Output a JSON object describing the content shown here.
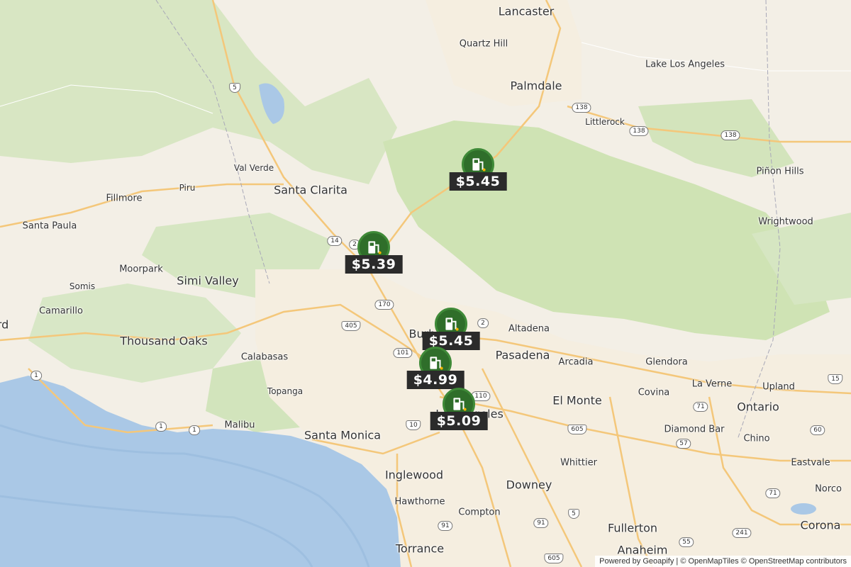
{
  "map": {
    "places": [
      {
        "name": "Lancaster",
        "size": "big"
      },
      {
        "name": "Quartz Hill",
        "size": "mid"
      },
      {
        "name": "Lake Los Angeles",
        "size": "mid"
      },
      {
        "name": "Palmdale",
        "size": "big"
      },
      {
        "name": "Littlerock",
        "size": "small"
      },
      {
        "name": "Val Verde",
        "size": "small"
      },
      {
        "name": "Santa Clarita",
        "size": "big"
      },
      {
        "name": "Piru",
        "size": "small"
      },
      {
        "name": "Fillmore",
        "size": "mid"
      },
      {
        "name": "Santa Paula",
        "size": "mid"
      },
      {
        "name": "Piñon Hills",
        "size": "mid"
      },
      {
        "name": "Wrightwood",
        "size": "mid"
      },
      {
        "name": "Moorpark",
        "size": "mid"
      },
      {
        "name": "Simi Valley",
        "size": "big"
      },
      {
        "name": "Somis",
        "size": "small"
      },
      {
        "name": "Camarillo",
        "size": "mid"
      },
      {
        "name": "rd",
        "size": "big"
      },
      {
        "name": "Thousand Oaks",
        "size": "big"
      },
      {
        "name": "Calabasas",
        "size": "mid"
      },
      {
        "name": "Altadena",
        "size": "mid"
      },
      {
        "name": "Burbank",
        "size": "big"
      },
      {
        "name": "Pasadena",
        "size": "big"
      },
      {
        "name": "Arcadia",
        "size": "mid"
      },
      {
        "name": "Glendora",
        "size": "mid"
      },
      {
        "name": "La Verne",
        "size": "mid"
      },
      {
        "name": "Upland",
        "size": "mid"
      },
      {
        "name": "Topanga",
        "size": "small"
      },
      {
        "name": "Covina",
        "size": "mid"
      },
      {
        "name": "El Monte",
        "size": "big"
      },
      {
        "name": "Ontario",
        "size": "big"
      },
      {
        "name": "Malibu",
        "size": "mid"
      },
      {
        "name": "Santa Monica",
        "size": "big"
      },
      {
        "name": "Los Angeles",
        "size": "big"
      },
      {
        "name": "Diamond Bar",
        "size": "mid"
      },
      {
        "name": "Chino",
        "size": "mid"
      },
      {
        "name": "Whittier",
        "size": "mid"
      },
      {
        "name": "Eastvale",
        "size": "mid"
      },
      {
        "name": "Inglewood",
        "size": "big"
      },
      {
        "name": "Downey",
        "size": "big"
      },
      {
        "name": "Norco",
        "size": "mid"
      },
      {
        "name": "Hawthorne",
        "size": "mid"
      },
      {
        "name": "Compton",
        "size": "mid"
      },
      {
        "name": "Fullerton",
        "size": "big"
      },
      {
        "name": "Corona",
        "size": "big"
      },
      {
        "name": "Torrance",
        "size": "big"
      },
      {
        "name": "Anaheim",
        "size": "big"
      }
    ],
    "shields": [
      {
        "label": "5",
        "type": "interstate"
      },
      {
        "label": "138",
        "type": "state"
      },
      {
        "label": "138",
        "type": "state"
      },
      {
        "label": "138",
        "type": "state"
      },
      {
        "label": "14",
        "type": "state"
      },
      {
        "label": "2",
        "type": "state"
      },
      {
        "label": "170",
        "type": "state"
      },
      {
        "label": "405",
        "type": "interstate"
      },
      {
        "label": "2",
        "type": "state"
      },
      {
        "label": "101",
        "type": "us"
      },
      {
        "label": "1",
        "type": "state"
      },
      {
        "label": "110",
        "type": "state"
      },
      {
        "label": "71",
        "type": "state"
      },
      {
        "label": "1",
        "type": "state"
      },
      {
        "label": "1",
        "type": "state"
      },
      {
        "label": "10",
        "type": "interstate"
      },
      {
        "label": "605",
        "type": "interstate"
      },
      {
        "label": "60",
        "type": "state"
      },
      {
        "label": "57",
        "type": "state"
      },
      {
        "label": "71",
        "type": "state"
      },
      {
        "label": "5",
        "type": "interstate"
      },
      {
        "label": "91",
        "type": "state"
      },
      {
        "label": "91",
        "type": "state"
      },
      {
        "label": "241",
        "type": "state"
      },
      {
        "label": "605",
        "type": "interstate"
      },
      {
        "label": "55",
        "type": "state"
      },
      {
        "label": "15",
        "type": "interstate"
      }
    ],
    "stations": [
      {
        "price": "$5.45"
      },
      {
        "price": "$5.39"
      },
      {
        "price": "$5.45"
      },
      {
        "price": "$4.99"
      },
      {
        "price": "$5.09"
      }
    ],
    "colors": {
      "marker": "#2f6e2a",
      "price_bg": "#2b2b2b",
      "water": "#aac8e6",
      "park": "#cfe3b4"
    }
  },
  "attribution": {
    "powered": "Powered by",
    "geoapify": "Geoapify",
    "rest": " | © OpenMapTiles © OpenStreetMap contributors"
  }
}
